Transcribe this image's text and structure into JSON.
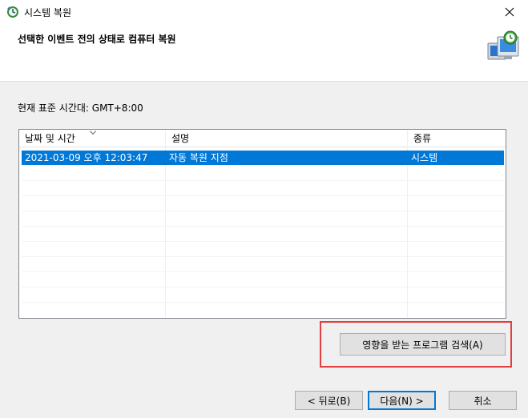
{
  "window": {
    "title": "시스템 복원",
    "icon": "system-restore-icon",
    "close_icon": "close-icon"
  },
  "header": {
    "title": "선택한 이벤트 전의 상태로 컴퓨터 복원",
    "icon": "system-restore-monitor-icon"
  },
  "timezone_label": "현재 표준 시간대: GMT+8:00",
  "list": {
    "columns": [
      "날짜 및 시간",
      "설명",
      "종류"
    ],
    "sorted_column_index": 0,
    "sort_icon": "chevron-down-icon",
    "rows": [
      {
        "date": "2021-03-09 오후 12:03:47",
        "description": "자동 복원 지점",
        "type": "시스템",
        "selected": true
      }
    ]
  },
  "scan_button_label": "영향을 받는 프로그램 검색(A)",
  "buttons": {
    "back": "< 뒤로(B)",
    "next": "다음(N) >",
    "cancel": "취소"
  },
  "colors": {
    "selection": "#0078d7",
    "highlight_box": "#e04040",
    "default_button_border": "#0078d7"
  }
}
